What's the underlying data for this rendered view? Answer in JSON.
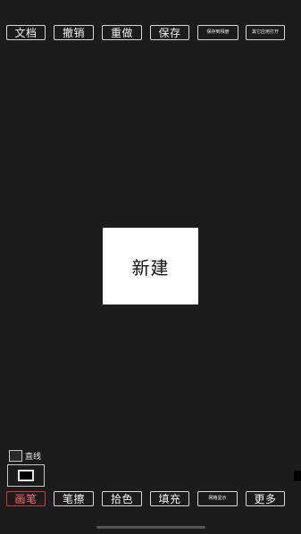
{
  "top_toolbar": {
    "document": "文档",
    "undo": "撤销",
    "redo": "重做",
    "save": "保存",
    "save_to_album": "保存到相册",
    "open_with_other_app": "其它应用打开"
  },
  "canvas": {
    "new_label": "新建"
  },
  "tools": {
    "line_label": "直线",
    "line_checked": false,
    "current_color": "#000000"
  },
  "bottom_toolbar": {
    "pen": "画笔",
    "eraser": "笔擦",
    "color_picker": "拾色",
    "fill": "填充",
    "grid_display": "网格显示",
    "more": "更多",
    "active_tool": "pen"
  },
  "colors": {
    "background": "#1c1c1c",
    "active_accent": "#cc3a3a"
  }
}
